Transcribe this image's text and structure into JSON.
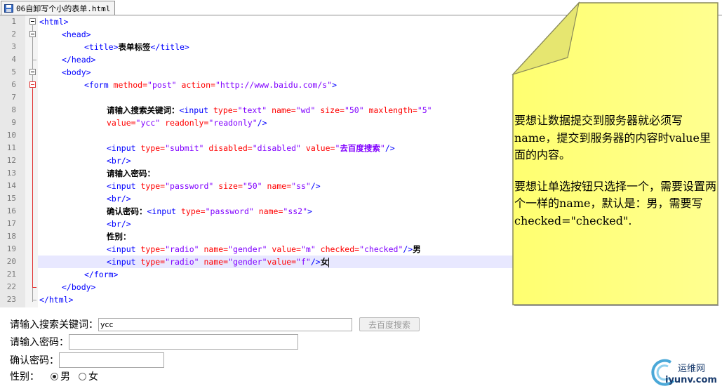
{
  "tab": {
    "filename": "06自卸写个小的表单.html"
  },
  "editor": {
    "line_numbers": [
      "1",
      "2",
      "3",
      "4",
      "5",
      "6",
      "7",
      "8",
      "9",
      "10",
      "11",
      "12",
      "13",
      "14",
      "15",
      "16",
      "17",
      "18",
      "19",
      "20",
      "21",
      "22",
      "23"
    ],
    "code": {
      "l1": [
        "<html>"
      ],
      "l2": [
        "<head>"
      ],
      "l3": [
        "<title>",
        "表单标签",
        "</title>"
      ],
      "l4": [
        "</head>"
      ],
      "l5": [
        "<body>"
      ],
      "l6": [
        "<form ",
        "method=",
        "\"post\"",
        " action=",
        "\"http://www.baidu.com/s\"",
        ">"
      ],
      "l8": [
        "请输入搜索关键词：",
        "<input ",
        "type=",
        "\"text\"",
        " name=",
        "\"wd\"",
        " size=",
        "\"50\"",
        " maxlength=",
        "\"5\""
      ],
      "l9": [
        "value=",
        "\"ycc\"",
        " readonly=",
        "\"readonly\"",
        "/>"
      ],
      "l11": [
        "<input ",
        "type=",
        "\"submit\"",
        " disabled=",
        "\"disabled\"",
        " value=",
        "\"",
        "去百度搜索",
        "\"",
        "/>"
      ],
      "l12": [
        "<br/>"
      ],
      "l13": [
        "请输入密码："
      ],
      "l14": [
        "<input ",
        "type=",
        "\"password\"",
        " size=",
        "\"50\"",
        " name=",
        "\"ss\"",
        "/>"
      ],
      "l15": [
        "<br/>"
      ],
      "l16": [
        "确认密码：",
        "<input ",
        "type=",
        "\"password\"",
        " name=",
        "\"ss2\"",
        ">"
      ],
      "l17": [
        "<br/>"
      ],
      "l18": [
        "性别："
      ],
      "l19": [
        "<input ",
        "type=",
        "\"radio\"",
        " name=",
        "\"gender\"",
        " value=",
        "\"m\"",
        " checked=",
        "\"checked\"",
        "/>",
        "男"
      ],
      "l20": [
        "<input ",
        "type=",
        "\"radio\"",
        " name=",
        "\"gender\"",
        "value=",
        "\"f\"",
        "/>",
        "女"
      ],
      "l21": [
        "</form>"
      ],
      "l22": [
        "</body>"
      ],
      "l23": [
        "</html>"
      ]
    }
  },
  "note": {
    "paragraph1": "要想让数据提交到服务器就必须写name，提交到服务器的内容时value里面的内容。",
    "paragraph2": "要想让单选按钮只选择一个，需要设置两个一样的name，默认是：男，需要写checked=\"checked\".",
    "color": "#ffff80"
  },
  "form": {
    "search_label": "请输入搜索关键词：",
    "search_value": "ycc",
    "search_button": "去百度搜索",
    "password_label": "请输入密码：",
    "confirm_label": "确认密码：",
    "gender_label": "性别：",
    "male_label": "男",
    "female_label": "女"
  },
  "watermark": {
    "name": "运维网",
    "url": "iyunv.com"
  },
  "colors": {
    "tag": "#0000ff",
    "attribute": "#ff0000",
    "value": "#8000ff",
    "current_line": "#e8e8ff"
  }
}
